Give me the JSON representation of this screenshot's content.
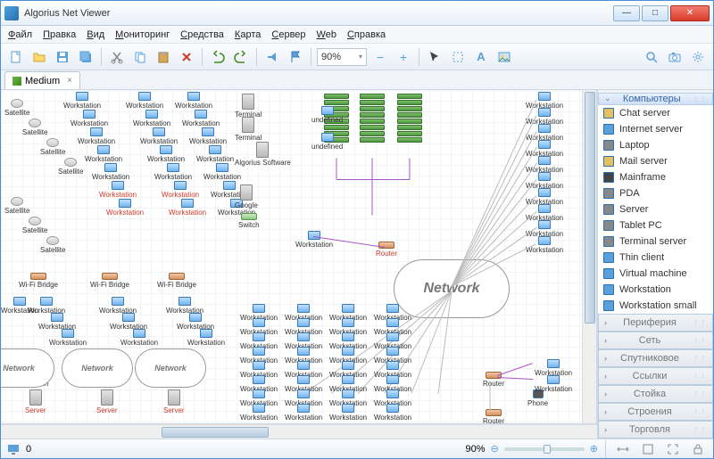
{
  "title": "Algorius Net Viewer",
  "menu": [
    "Файл",
    "Правка",
    "Вид",
    "Мониторинг",
    "Средства",
    "Карта",
    "Сервер",
    "Web",
    "Справка"
  ],
  "zoom": "90%",
  "tab": {
    "label": "Medium"
  },
  "side": {
    "header": "Компьютеры",
    "items": [
      "Chat server",
      "Internet server",
      "Laptop",
      "Mail server",
      "Mainframe",
      "PDA",
      "Server",
      "Tablet PC",
      "Terminal server",
      "Thin client",
      "Virtual machine",
      "Workstation",
      "Workstation small"
    ],
    "groups": [
      "Периферия",
      "Сеть",
      "Спутниковое",
      "Ссылки",
      "Стойка",
      "Строения",
      "Торговля"
    ]
  },
  "status": {
    "count": "0",
    "zoom": "90%"
  },
  "labels": {
    "ws": "Workstation",
    "sat": "Satellite",
    "term": "Terminal",
    "alg": "Algorius Software",
    "goog": "Google",
    "sw": "Switch",
    "rtr": "Router",
    "srv": "Server",
    "wifi": "Wi-Fi Bridge",
    "phone": "Phone",
    "net": "Network",
    "netbig": "Network"
  }
}
